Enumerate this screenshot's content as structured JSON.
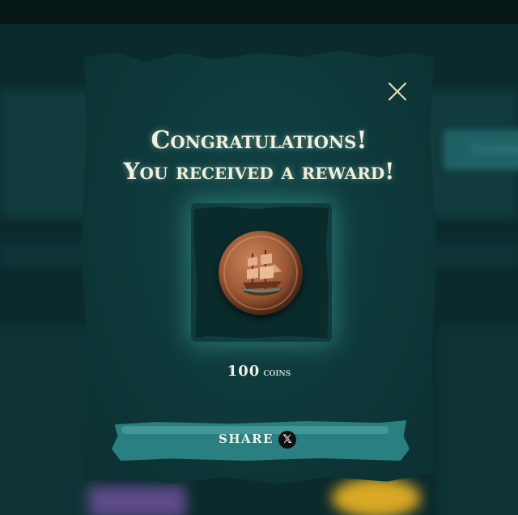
{
  "background": {
    "side_button_label": "Exchange"
  },
  "modal": {
    "close_icon": "close-icon",
    "title_line1": "Congratulations!",
    "title_line2": "You received a reward!",
    "reward": {
      "image": "ship-coin-icon",
      "amount": "100",
      "unit": "coins"
    },
    "share_label": "SHARE",
    "share_icon": "x-logo-icon"
  },
  "colors": {
    "panel": "#0e3b3c",
    "accent": "#2a7f80",
    "title": "#f3efd8",
    "close": "#e8d9b0"
  }
}
